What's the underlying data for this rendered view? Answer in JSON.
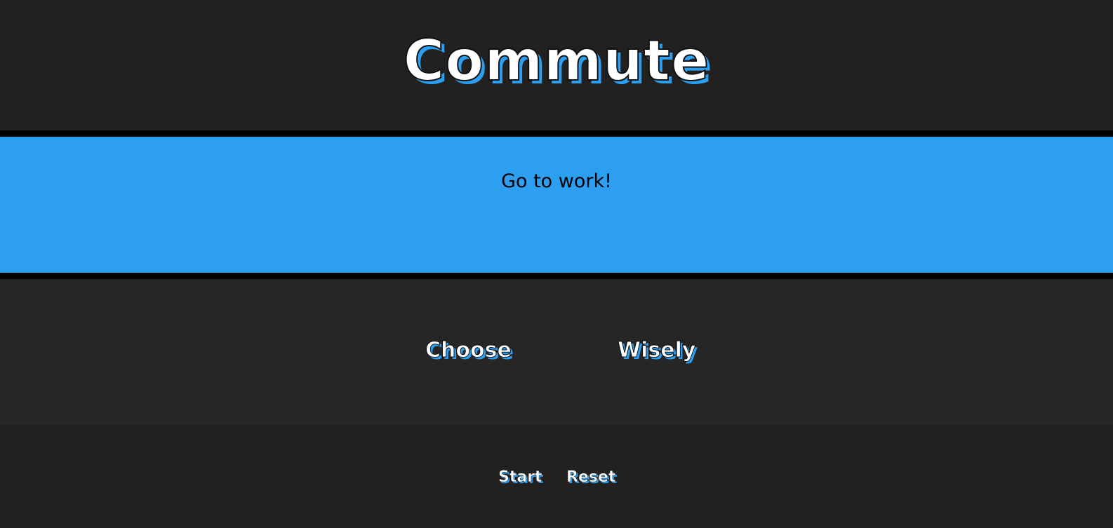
{
  "header": {
    "title": "Commute"
  },
  "message_panel": {
    "text": "Go to work!"
  },
  "choices": {
    "left_label": "Choose",
    "right_label": "Wisely"
  },
  "controls": {
    "start_label": "Start",
    "reset_label": "Reset"
  },
  "colors": {
    "background": "#222120",
    "accent": "#2c9ff1",
    "divider": "#000000",
    "text": "#ffffff"
  }
}
